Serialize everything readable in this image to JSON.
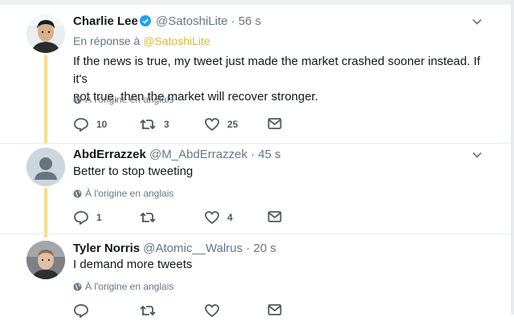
{
  "accent_color": "#e0b93a",
  "thread_line_color": "#f5dd8f",
  "tweets": [
    {
      "name": "Charlie Lee",
      "verified": true,
      "handle": "@SatoshiLite",
      "time": "· 56 s",
      "reply_prefix": "En réponse à",
      "reply_mention": "@SatoshiLite",
      "text_lines": [
        "If the news is true, my tweet just made the market crashed sooner instead. If it's",
        "not true, then the market will recover stronger."
      ],
      "translate_label": "À l'origine en anglais",
      "reply_count": "10",
      "retweet_count": "3",
      "like_count": "25",
      "avatar": "avatar-photo-charlie"
    },
    {
      "name": "AbdErrazzek",
      "verified": false,
      "handle": "@M_AbdErrazzek",
      "time": "· 45 s",
      "text_lines": [
        "Better to stop tweeting"
      ],
      "translate_label": "À l'origine en anglais",
      "reply_count": "1",
      "retweet_count": "",
      "like_count": "4",
      "avatar": "default-avatar-icon"
    },
    {
      "name": "Tyler Norris",
      "verified": false,
      "handle": "@Atomic__Walrus",
      "time": "· 20 s",
      "text_lines": [
        "I demand more tweets"
      ],
      "translate_label": "À l'origine en anglais",
      "reply_count": "",
      "retweet_count": "",
      "like_count": "",
      "avatar": "avatar-photo-tyler"
    }
  ]
}
